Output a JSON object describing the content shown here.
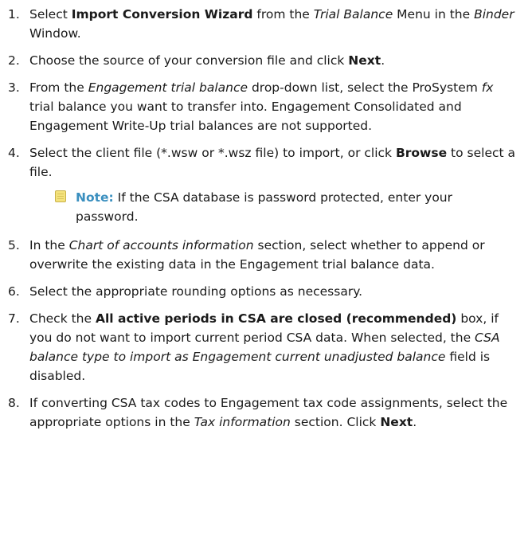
{
  "steps": [
    {
      "number": "1.",
      "parts": [
        "Select ",
        "Import Conversion Wizard",
        " from the ",
        "Trial Balance",
        " Menu in the ",
        "Binder",
        " Window."
      ]
    },
    {
      "number": "2.",
      "parts": [
        "Choose the source of your conversion file and click ",
        "Next",
        "."
      ]
    },
    {
      "number": "3.",
      "parts": [
        "From the ",
        "Engagement trial balance",
        " drop-down list, select the ProSystem ",
        "fx",
        " trial balance you want to transfer into. Engagement Consolidated and Engagement Write-Up trial balances are not supported."
      ]
    },
    {
      "number": "4.",
      "parts": [
        "Select the client file (*.wsw or *.wsz file) to import, or click ",
        "Browse",
        " to select a file."
      ],
      "note": {
        "icon": "note-icon",
        "label": "Note:",
        "text": " If the CSA database is password protected, enter your password."
      }
    },
    {
      "number": "5.",
      "parts": [
        "In the ",
        "Chart of accounts information",
        " section, select whether to append or overwrite the existing data in the Engagement trial balance data."
      ]
    },
    {
      "number": "6.",
      "parts": [
        "Select the appropriate rounding options as necessary."
      ]
    },
    {
      "number": "7.",
      "parts": [
        "Check the ",
        "All active periods in CSA are closed (recommended)",
        " box, if you do not want to import current period CSA data. When selected, the ",
        "CSA balance type to import as Engagement current unadjusted balance",
        " field is disabled."
      ]
    },
    {
      "number": "8.",
      "parts": [
        "If converting CSA tax codes to Engagement tax code assignments, select the appropriate options in the ",
        "Tax information",
        " section. Click ",
        "Next",
        "."
      ]
    }
  ]
}
